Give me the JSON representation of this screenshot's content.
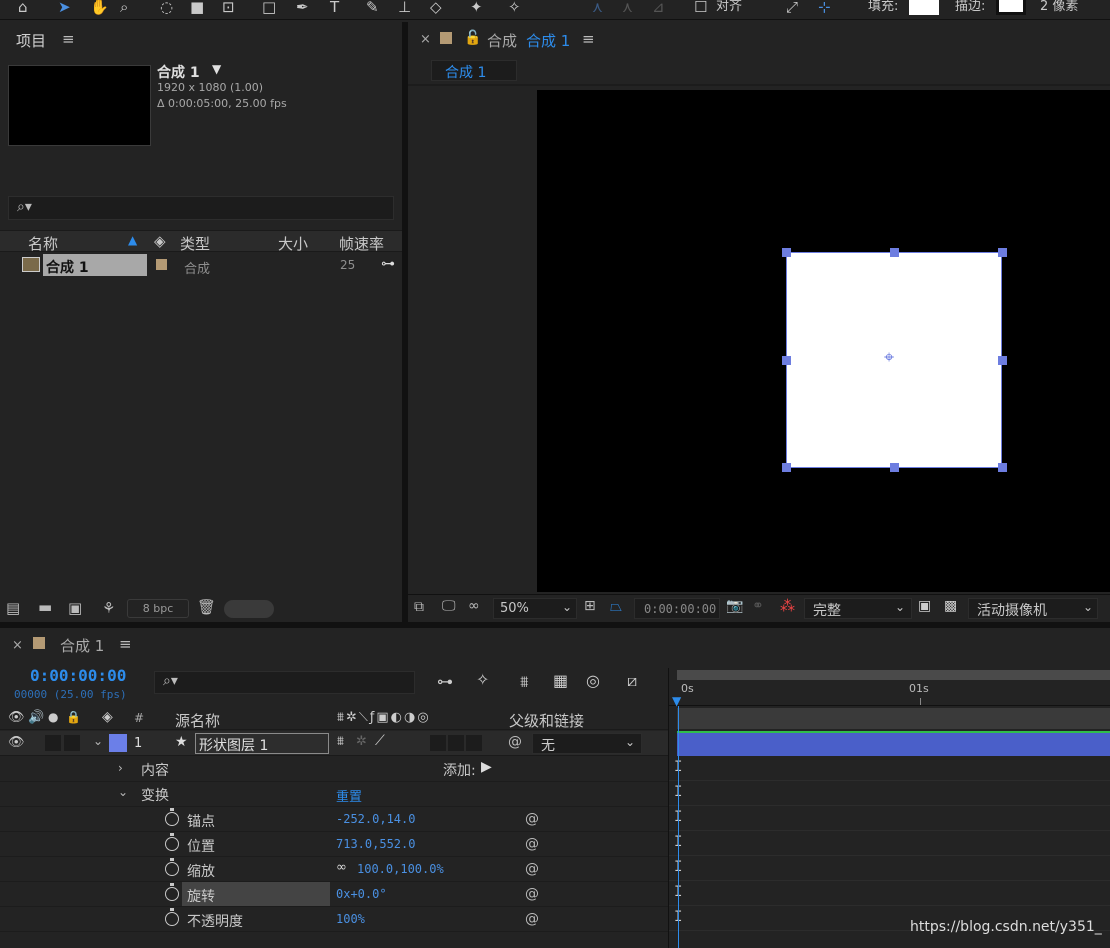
{
  "toolbar": {
    "align_label": "对齐",
    "fill_label": "填充:",
    "stroke_label": "描边:",
    "stroke_width": "2 像素"
  },
  "project": {
    "title": "项目",
    "comp_name": "合成 1",
    "comp_dims": "1920 x 1080 (1.00)",
    "comp_duration": "Δ 0:00:05:00, 25.00 fps",
    "columns": [
      "名称",
      "类型",
      "大小",
      "帧速率"
    ],
    "items": [
      {
        "name": "合成 1",
        "type": "合成",
        "size": "",
        "fps": "25"
      }
    ],
    "bpc": "8 bpc"
  },
  "viewer": {
    "title_prefix": "合成",
    "title_link": "合成 1",
    "tab": "合成 1",
    "zoom": "50%",
    "timecode": "0:00:00:00",
    "resolution": "完整",
    "camera": "活动摄像机"
  },
  "timeline": {
    "title": "合成 1",
    "timecode": "0:00:00:00",
    "frames": "00000 (25.00 fps)",
    "col_source": "源名称",
    "col_parent": "父级和链接",
    "col_num": "#",
    "layer": {
      "index": "1",
      "name": "形状图层 1",
      "parent": "无"
    },
    "content_label": "内容",
    "add_label": "添加:",
    "transform_label": "变换",
    "reset_label": "重置",
    "ruler": [
      "0s",
      "01s"
    ],
    "properties": [
      {
        "name": "锚点",
        "value": "-252.0,14.0"
      },
      {
        "name": "位置",
        "value": "713.0,552.0"
      },
      {
        "name": "缩放",
        "value": "100.0,100.0%"
      },
      {
        "name": "旋转",
        "value": "0x+0.0°"
      },
      {
        "name": "不透明度",
        "value": "100%"
      }
    ],
    "watermark": "https://blog.csdn.net/y351_"
  },
  "colors": {
    "accent": "#2d8ceb",
    "layer_label": "#6b7fe8",
    "layer_bar": "#4a5fc9",
    "handle": "#6d7de0"
  }
}
